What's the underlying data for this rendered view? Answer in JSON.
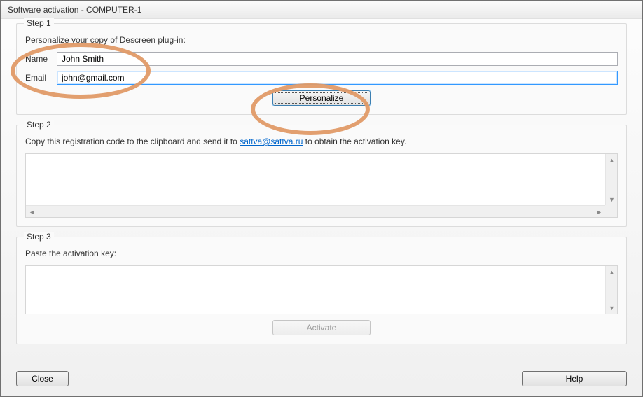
{
  "window": {
    "title": "Software activation - COMPUTER-1"
  },
  "step1": {
    "title": "Step 1",
    "instruction": "Personalize your copy of Descreen plug-in:",
    "name_label": "Name",
    "name_value": "John Smith",
    "email_label": "Email",
    "email_value": "john@gmail.com",
    "button": "Personalize"
  },
  "step2": {
    "title": "Step 2",
    "instruction_pre": "Copy this registration code to the clipboard and send it to ",
    "link_text": "sattva@sattva.ru",
    "instruction_post": " to obtain the activation key.",
    "code_value": ""
  },
  "step3": {
    "title": "Step 3",
    "instruction": "Paste the activation key:",
    "key_value": "",
    "button": "Activate"
  },
  "footer": {
    "close": "Close",
    "help": "Help"
  },
  "scroll": {
    "up": "▲",
    "down": "▼",
    "left": "◄",
    "right": "►"
  }
}
